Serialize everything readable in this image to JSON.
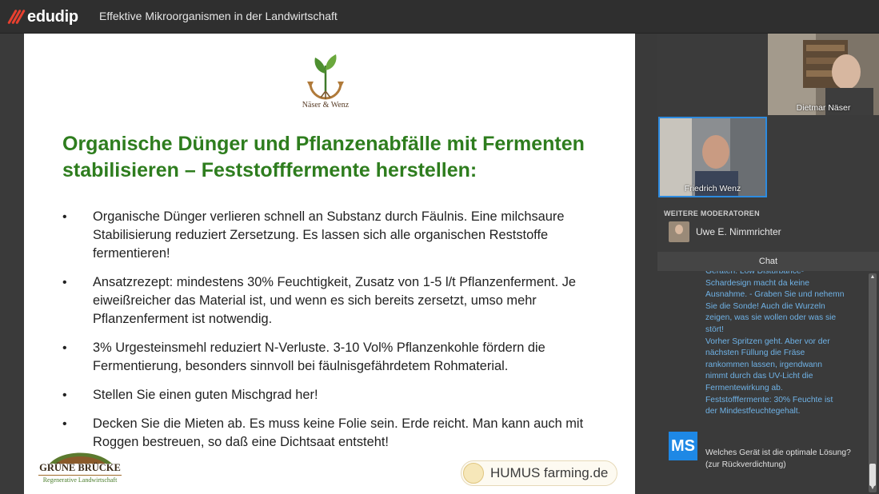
{
  "app": {
    "logo_text": "edudip",
    "title": "Effektive Mikroorganismen in der Landwirtschaft"
  },
  "slide": {
    "logo_text": "Näser & Wenz",
    "title_line1": "Organische Dünger und Pflanzenabfälle mit Fermenten",
    "title_line2": "stabilisieren – Feststofffermente herstellen:",
    "bullets": [
      "Organische Dünger verlieren schnell an Substanz durch Fäulnis. Eine milchsaure Stabilisierung reduziert Zersetzung. Es lassen sich alle organischen Reststoffe fermentieren!",
      "Ansatzrezept: mindestens 30% Feuchtigkeit, Zusatz von 1-5 l/t Pflanzenferment. Je eiweißreicher das Material ist, und wenn es sich bereits zersetzt, umso mehr Pflanzenferment ist notwendig.",
      "3% Urgesteinsmehl reduziert N-Verluste. 3-10 Vol% Pflanzenkohle fördern die Fermentierung, besonders sinnvoll bei fäulnisgefährdetem Rohmaterial.",
      "Stellen Sie einen guten Mischgrad her!",
      "Decken Sie die Mieten ab. Es muss keine Folie sein. Erde reicht. Man kann auch mit Roggen bestreuen, so daß eine Dichtsaat entsteht!"
    ],
    "bullet_glyph": "•",
    "footer_left_title": "GRÜNE BRÜCKE",
    "footer_left_sub": "Regenerative Landwirtschaft",
    "footer_right": "HUMUS farming.de"
  },
  "videos": {
    "presenter1": "Dietmar Näser",
    "presenter2": "Friedrich Wenz"
  },
  "moderators": {
    "label": "WEITERE MODERATOREN",
    "items": [
      {
        "name": "Uwe E. Nimmrichter"
      }
    ]
  },
  "chat": {
    "header": "Chat",
    "message1_lines": [
      "Geräten. Low Disturbance-",
      "Schardesign macht da keine",
      "Ausnahme. - Graben Sie und nehemn",
      "Sie die Sonde! Auch die Wurzeln",
      "zeigen, was sie wollen oder was sie",
      "stört!",
      "Vorher Spritzen geht. Aber vor der",
      "nächsten Füllung die Fräse",
      "rankommen lassen, irgendwann",
      "nimmt durch das UV-Licht die",
      "Fermentewirkung ab.",
      "Feststofffermente: 30% Feuchte ist",
      "der Mindestfeuchtegehalt."
    ],
    "message2_avatar": "MS",
    "message2": "Welches Gerät ist die optimale Lösung? (zur Rückverdichtung)"
  },
  "colors": {
    "title_green": "#2e7d1e",
    "accent_blue": "#2d8be0",
    "chat_blue": "#6fb2e6",
    "brand_red": "#e8402f"
  }
}
